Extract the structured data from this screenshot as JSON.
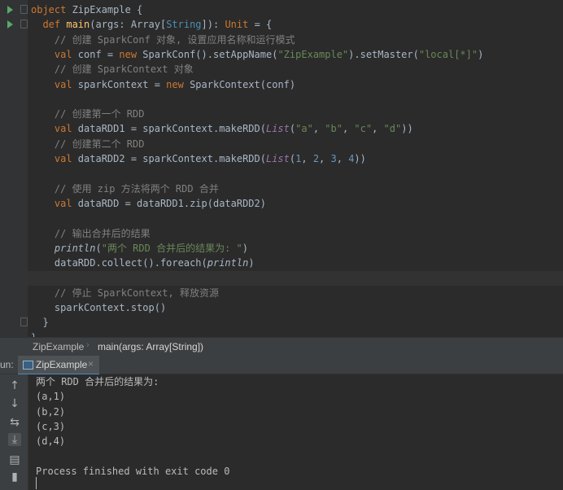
{
  "editor": {
    "lines": [
      {
        "segs": [
          [
            "kw",
            "object "
          ],
          [
            "obj",
            "ZipExample {"
          ]
        ]
      },
      {
        "segs": [
          [
            "kw",
            "  def "
          ],
          [
            "fn",
            "main"
          ],
          [
            "",
            "(args: Array["
          ],
          [
            "ty",
            "String"
          ],
          [
            "",
            "]): "
          ],
          [
            "kw",
            "Unit"
          ],
          [
            "",
            " = {"
          ]
        ]
      },
      {
        "segs": [
          [
            "cm",
            "    // 创建 SparkConf 对象, 设置应用名称和运行模式"
          ]
        ]
      },
      {
        "segs": [
          [
            "kw",
            "    val "
          ],
          [
            "",
            "conf = "
          ],
          [
            "kw",
            "new "
          ],
          [
            "",
            "SparkConf().setAppName("
          ],
          [
            "str",
            "\"ZipExample\""
          ],
          [
            "",
            ").setMaster("
          ],
          [
            "str",
            "\"local[*]\""
          ],
          [
            "",
            ")"
          ]
        ]
      },
      {
        "segs": [
          [
            "cm",
            "    // 创建 SparkContext 对象"
          ]
        ]
      },
      {
        "segs": [
          [
            "kw",
            "    val "
          ],
          [
            "",
            "sparkContext = "
          ],
          [
            "kw",
            "new "
          ],
          [
            "",
            "SparkContext(conf)"
          ]
        ]
      },
      {
        "segs": [
          [
            "",
            ""
          ]
        ]
      },
      {
        "segs": [
          [
            "cm",
            "    // 创建第一个 RDD"
          ]
        ]
      },
      {
        "segs": [
          [
            "kw",
            "    val "
          ],
          [
            "",
            "dataRDD1 = sparkContext.makeRDD("
          ],
          [
            "it",
            "List"
          ],
          [
            "",
            "("
          ],
          [
            "str",
            "\"a\""
          ],
          [
            "",
            ", "
          ],
          [
            "str",
            "\"b\""
          ],
          [
            "",
            ", "
          ],
          [
            "str",
            "\"c\""
          ],
          [
            "",
            ", "
          ],
          [
            "str",
            "\"d\""
          ],
          [
            "",
            "))"
          ]
        ]
      },
      {
        "segs": [
          [
            "cm",
            "    // 创建第二个 RDD"
          ]
        ]
      },
      {
        "segs": [
          [
            "kw",
            "    val "
          ],
          [
            "",
            "dataRDD2 = sparkContext.makeRDD("
          ],
          [
            "it",
            "List"
          ],
          [
            "",
            "("
          ],
          [
            "num",
            "1"
          ],
          [
            "",
            ", "
          ],
          [
            "num",
            "2"
          ],
          [
            "",
            ", "
          ],
          [
            "num",
            "3"
          ],
          [
            "",
            ", "
          ],
          [
            "num",
            "4"
          ],
          [
            "",
            "))"
          ]
        ]
      },
      {
        "segs": [
          [
            "",
            ""
          ]
        ]
      },
      {
        "segs": [
          [
            "cm",
            "    // 使用 zip 方法将两个 RDD 合并"
          ]
        ]
      },
      {
        "segs": [
          [
            "kw",
            "    val "
          ],
          [
            "",
            "dataRDD = dataRDD1.zip(dataRDD2)"
          ]
        ]
      },
      {
        "segs": [
          [
            "",
            ""
          ]
        ]
      },
      {
        "segs": [
          [
            "cm",
            "    // 输出合并后的结果"
          ]
        ]
      },
      {
        "segs": [
          [
            "itf",
            "    println"
          ],
          [
            "",
            "("
          ],
          [
            "str",
            "\"两个 RDD 合并后的结果为: \""
          ],
          [
            "",
            ")"
          ]
        ]
      },
      {
        "segs": [
          [
            "",
            "    dataRDD.collect().foreach("
          ],
          [
            "itf",
            "println"
          ],
          [
            "",
            ")"
          ]
        ]
      },
      {
        "segs": [
          [
            "",
            ""
          ]
        ]
      },
      {
        "segs": [
          [
            "cm",
            "    // 停止 SparkContext, 释放资源"
          ]
        ]
      },
      {
        "segs": [
          [
            "",
            "    sparkContext.stop()"
          ]
        ]
      },
      {
        "segs": [
          [
            "",
            "  }"
          ]
        ]
      },
      {
        "segs": [
          [
            "",
            "}"
          ]
        ]
      }
    ]
  },
  "breadcrumb": {
    "items": [
      "ZipExample",
      "main(args: Array[String])"
    ],
    "separator": "›"
  },
  "run_panel": {
    "label": "un:",
    "tab_label": "ZipExample",
    "tab_close": "×"
  },
  "console": {
    "lines": [
      "两个 RDD 合并后的结果为:",
      "(a,1)",
      "(b,2)",
      "(c,3)",
      "(d,4)",
      "",
      "Process finished with exit code 0"
    ]
  },
  "tools": [
    {
      "icon": "arrow-up-icon",
      "glyph": "↑"
    },
    {
      "icon": "arrow-down-icon",
      "glyph": "↓"
    },
    {
      "icon": "soft-wrap-icon",
      "glyph": "⇆"
    },
    {
      "icon": "scroll-to-end-icon",
      "glyph": "⤓"
    },
    {
      "icon": "print-icon",
      "glyph": "▤"
    },
    {
      "icon": "trash-icon",
      "glyph": "▮"
    }
  ],
  "colors": {
    "accent": "#4a88c7",
    "run_green": "#59a869"
  }
}
